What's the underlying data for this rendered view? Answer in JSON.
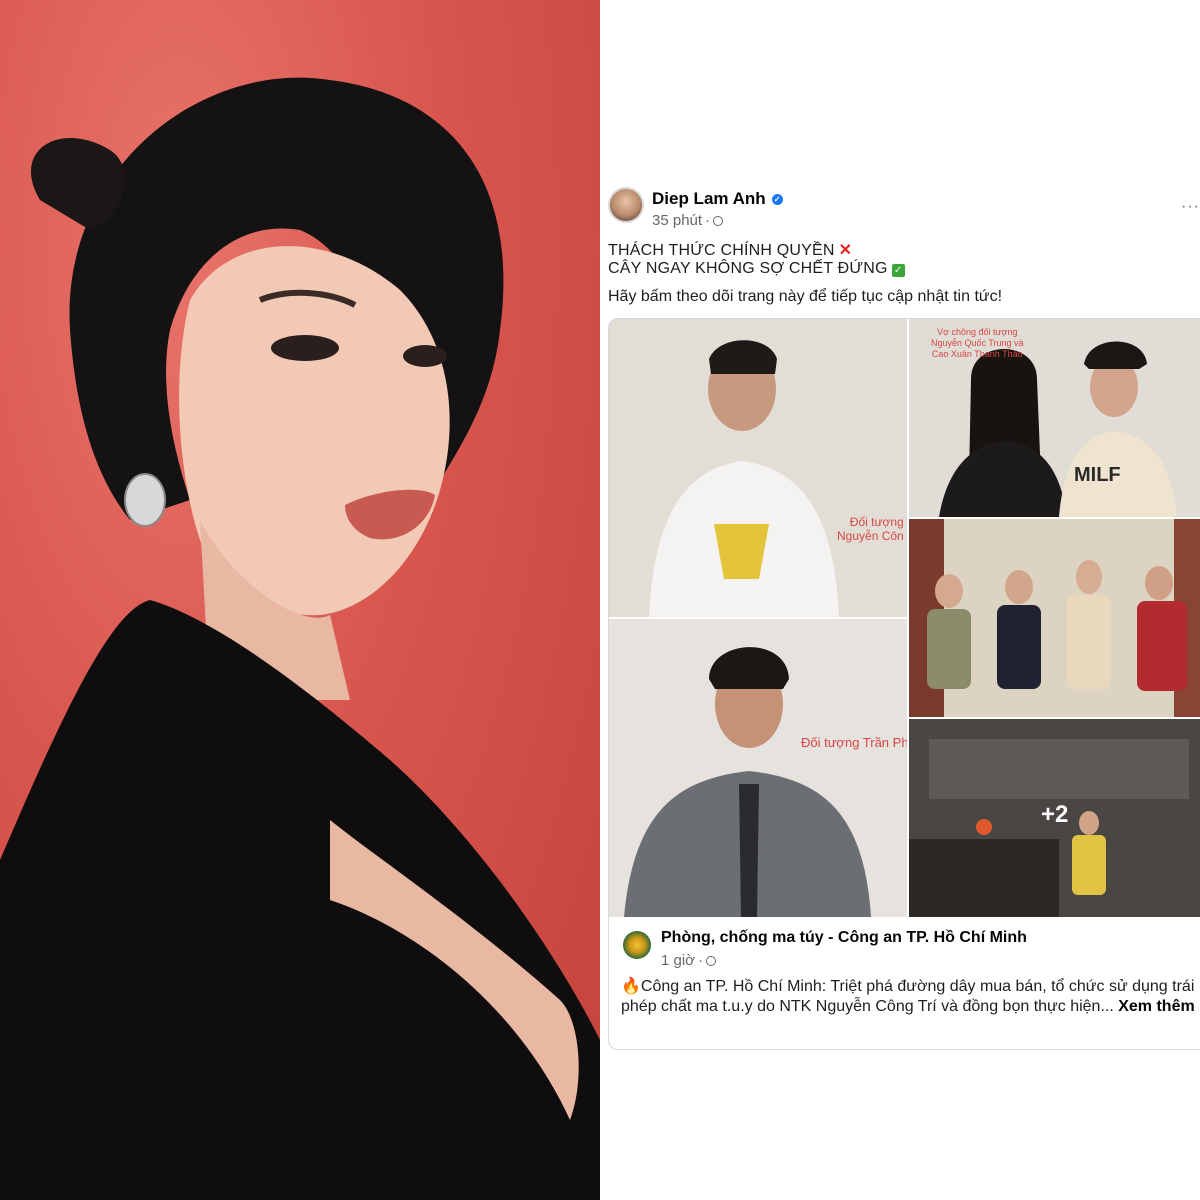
{
  "post": {
    "author": "Diep Lam Anh",
    "time": "35 phút",
    "separator": "·",
    "more": "···",
    "line1": "THÁCH THỨC CHÍNH QUYỀN",
    "line2": "CÂY NGAY KHÔNG SỢ CHẾT ĐỨNG",
    "line3": "Hãy bấm theo dõi trang này để tiếp tục cập nhật tin tức!",
    "x_mark": "✕",
    "check_mark": "✓"
  },
  "photos": {
    "label1": "Đối tượng\nNguyễn Côn",
    "label2": "Vợ chồng đối tượng\nNguyễn Quốc Trung và\nCao Xuân Thanh Thảo",
    "label4": "Đối tượng Trần Ph",
    "shirt_text": "MILF",
    "more_count": "+2"
  },
  "shared": {
    "page_name": "Phòng, chống ma túy - Công an TP. Hồ Chí Minh",
    "time": "1 giờ",
    "separator": "·",
    "text": "🔥Công an TP. Hồ Chí Minh: Triệt phá đường dây mua bán, tổ chức sử dụng trái phép chất ma t.u.y do NTK Nguyễn Công Trí và đồng bọn thực hiện... ",
    "see_more": "Xem thêm"
  },
  "colors": {
    "portrait_bg": "#d8564e",
    "accent_blue": "#1877f2",
    "label_red": "#d94545"
  }
}
